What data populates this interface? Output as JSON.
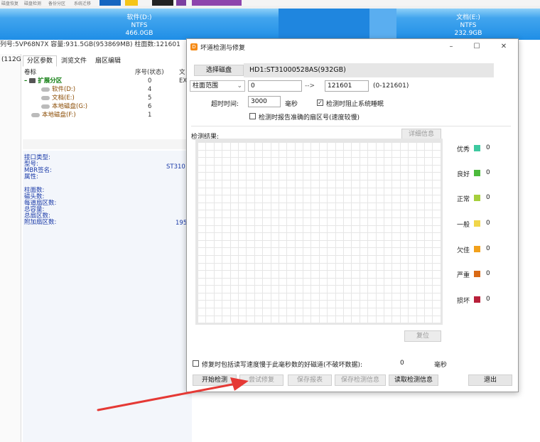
{
  "top_strip": {
    "left_labels": [
      "磁盘恢复",
      "磁盘检测",
      "备份分区",
      "系统迁移"
    ]
  },
  "disk_map": {
    "partitions": [
      {
        "name": "软件(D:)",
        "fs": "NTFS",
        "size": "466.0GB"
      },
      {
        "name": "文档(E:)",
        "fs": "NTFS",
        "size": "232.9GB"
      }
    ]
  },
  "serial_line": "列号:5VP68N7X  容量:931.5GB(953869MB)  柱面数:121601",
  "left_tree": {
    "label": "(112G"
  },
  "tabs": [
    {
      "label": "分区参数"
    },
    {
      "label": "浏览文件"
    },
    {
      "label": "扇区编辑"
    }
  ],
  "partition_table": {
    "headers": {
      "label": "卷标",
      "index": "序号(状态)",
      "fs": "文"
    },
    "rows": [
      {
        "name": "扩展分区",
        "index": "0",
        "fs": "EX"
      },
      {
        "name": "软件(D:)",
        "index": "4",
        "fs": ""
      },
      {
        "name": "文档(E:)",
        "index": "5",
        "fs": ""
      },
      {
        "name": "本地磁盘(G:)",
        "index": "6",
        "fs": ""
      },
      {
        "name": "本地磁盘(F:)",
        "index": "1",
        "fs": ""
      }
    ]
  },
  "info_pane": {
    "group1": [
      "接口类型:",
      "型号:",
      "MBR签名:",
      "属性:"
    ],
    "group2": [
      "柱面数:",
      "磁头数:",
      "每道扇区数:",
      "总容量:",
      "总扇区数:",
      "附加扇区数:"
    ],
    "model_value": "ST310",
    "sectors_value": "195"
  },
  "dialog": {
    "title": "坏道检测与修复",
    "window_controls": {
      "minimize": "–",
      "maximize": "☐",
      "close": "✕"
    },
    "select_disk_label": "选择磁盘",
    "disk_name": "HD1:ST31000528AS(932GB)",
    "range_type": "柱面范围",
    "range_start": "0",
    "range_arrow": "-->",
    "range_end": "121601",
    "range_hint": "(0-121601)",
    "timeout_label": "超时时间:",
    "timeout_value": "3000",
    "timeout_unit": "毫秒",
    "prevent_sleep_label": "检测时阻止系统睡眠",
    "prevent_sleep_checked": true,
    "report_sector_label": "检测时报告准确的扇区号(速度较慢)",
    "report_sector_checked": false,
    "result_label": "检测结果:",
    "details_button": "详细信息",
    "reset_button": "复位",
    "legend": [
      {
        "label": "优秀",
        "color": "#3ec9a0",
        "count": "0"
      },
      {
        "label": "良好",
        "color": "#4cbb3c",
        "count": "0"
      },
      {
        "label": "正常",
        "color": "#a6cf3c",
        "count": "0"
      },
      {
        "label": "一般",
        "color": "#f1d64a",
        "count": "0"
      },
      {
        "label": "欠佳",
        "color": "#f2a11c",
        "count": "0"
      },
      {
        "label": "严重",
        "color": "#d96a16",
        "count": "0"
      },
      {
        "label": "损坏",
        "color": "#b8203a",
        "count": "0"
      }
    ],
    "repair_option_label": "修复时包括读写速度慢于此毫秒数的好磁道(不破坏数据):",
    "repair_option_value": "0",
    "repair_option_unit": "毫秒",
    "buttons": {
      "start": "开始检测",
      "try_repair": "尝试修复",
      "save_report": "保存报表",
      "save_info": "保存检测信息",
      "read_info": "读取检测信息",
      "exit": "退出"
    }
  },
  "colors": {
    "accent_blue": "#1f8ee6",
    "arrow_red": "#e53935",
    "dialog_icon": "#f58a15"
  }
}
